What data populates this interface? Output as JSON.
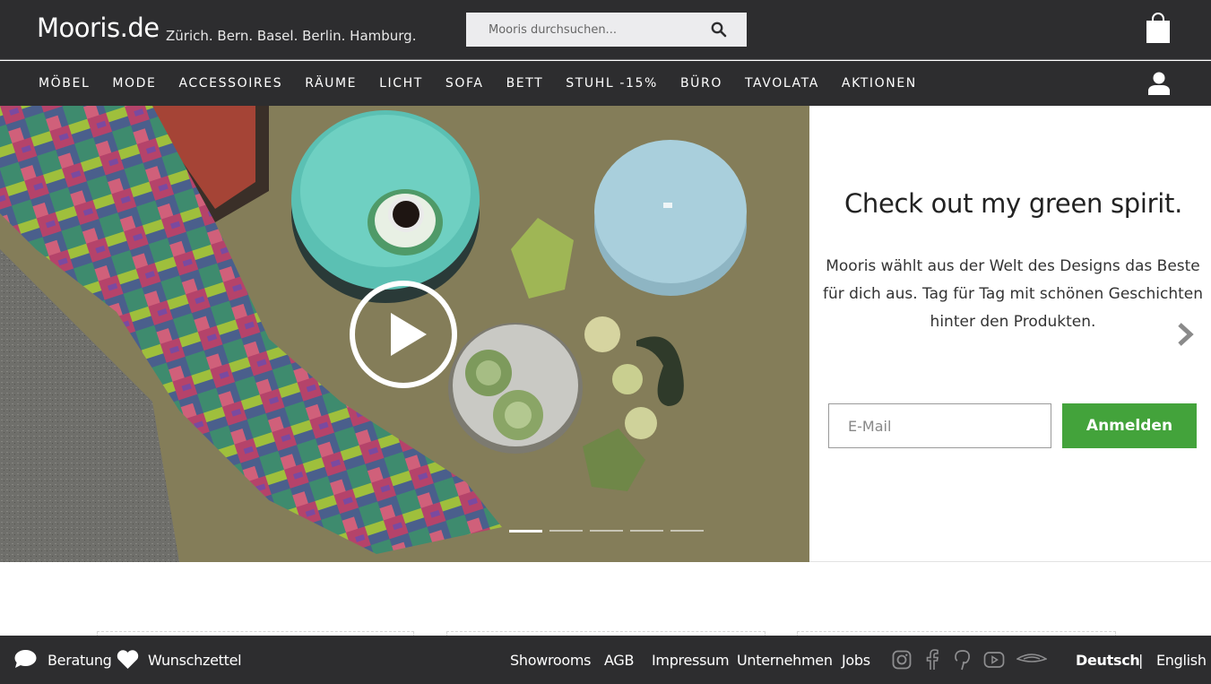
{
  "header": {
    "logo": "Mooris.de",
    "cities": "Zürich. Bern. Basel. Berlin. Hamburg.",
    "search_placeholder": "Mooris durchsuchen...",
    "icons": [
      "search-icon",
      "shopping-bag-icon",
      "user-icon"
    ]
  },
  "nav": {
    "items": [
      "MÖBEL",
      "MODE",
      "ACCESSOIRES",
      "RÄUME",
      "LICHT",
      "SOFA",
      "BETT",
      "STUHL -15%",
      "BÜRO",
      "TAVOLATA",
      "AKTIONEN"
    ]
  },
  "hero": {
    "slides_total": 5,
    "active_slide": 1,
    "icons": [
      "play-icon"
    ]
  },
  "promo": {
    "title": "Check out my green spirit.",
    "text": "Mooris wählt aus der Welt des Designs das Beste für dich aus. Tag für Tag mit schönen Geschichten hinter den Produkten.",
    "email_placeholder": "E-Mail",
    "signup_label": "Anmelden",
    "icons": [
      "chevron-right-icon"
    ]
  },
  "footer": {
    "beratung": "Beratung",
    "wunschzettel": "Wunschzettel",
    "links": [
      "Showrooms",
      "AGB",
      "Impressum",
      "Unternehmen",
      "Jobs"
    ],
    "lang_active": "Deutsch",
    "lang_sep": "|",
    "lang_other": "English",
    "social_icons": [
      "instagram-icon",
      "facebook-icon",
      "pinterest-icon",
      "youtube-icon",
      "mooris-magazine-icon"
    ]
  },
  "colors": {
    "header_bg": "#2d2d2f",
    "accent_green": "#43a33b",
    "search_bg": "#ececee"
  }
}
